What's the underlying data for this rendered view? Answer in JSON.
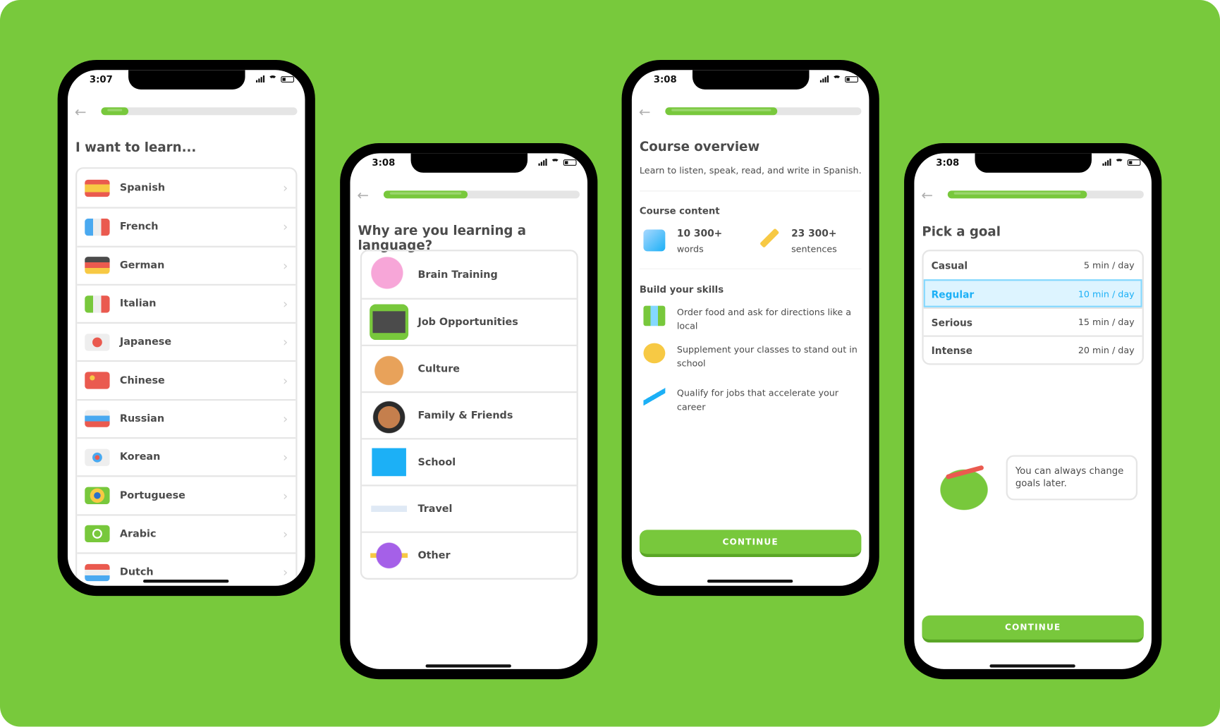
{
  "background_color": "#78c93c",
  "accent_color": "#78c83c",
  "phones": [
    {
      "time": "3:07",
      "progress": 0.14,
      "title": "I want to learn...",
      "languages": [
        {
          "label": "Spanish",
          "icon": "flag-spain"
        },
        {
          "label": "French",
          "icon": "flag-france"
        },
        {
          "label": "German",
          "icon": "flag-germany"
        },
        {
          "label": "Italian",
          "icon": "flag-italy"
        },
        {
          "label": "Japanese",
          "icon": "flag-japan"
        },
        {
          "label": "Chinese",
          "icon": "flag-china"
        },
        {
          "label": "Russian",
          "icon": "flag-russia"
        },
        {
          "label": "Korean",
          "icon": "flag-korea"
        },
        {
          "label": "Portuguese",
          "icon": "flag-brazil"
        },
        {
          "label": "Arabic",
          "icon": "flag-arabic"
        },
        {
          "label": "Dutch",
          "icon": "flag-netherlands"
        }
      ]
    },
    {
      "time": "3:08",
      "progress": 0.43,
      "title": "Why are you learning a language?",
      "reasons": [
        {
          "label": "Brain Training",
          "icon": "brain-icon"
        },
        {
          "label": "Job Opportunities",
          "icon": "laptop-chart-icon"
        },
        {
          "label": "Culture",
          "icon": "palette-icon"
        },
        {
          "label": "Family & Friends",
          "icon": "person-icon"
        },
        {
          "label": "School",
          "icon": "book-icon"
        },
        {
          "label": "Travel",
          "icon": "airplane-icon"
        },
        {
          "label": "Other",
          "icon": "planet-icon"
        }
      ]
    },
    {
      "time": "3:08",
      "progress": 0.57,
      "title": "Course overview",
      "subtitle": "Learn to listen, speak, read, and write in Spanish.",
      "content_heading": "Course content",
      "stats": [
        {
          "value": "10 300+",
          "unit": "words",
          "icon": "cards-icon"
        },
        {
          "value": "23 300+",
          "unit": "sentences",
          "icon": "pencil-icon"
        }
      ],
      "skills_heading": "Build your skills",
      "skills": [
        {
          "text": "Order food and ask for directions like a local",
          "icon": "map-icon"
        },
        {
          "text": "Supplement your classes to stand out in school",
          "icon": "lightbulb-icon"
        },
        {
          "text": "Qualify for jobs that accelerate your career",
          "icon": "trend-up-icon"
        }
      ],
      "continue_label": "CONTINUE"
    },
    {
      "time": "3:08",
      "progress": 0.71,
      "title": "Pick a goal",
      "goals": [
        {
          "name": "Casual",
          "time": "5 min / day",
          "selected": false
        },
        {
          "name": "Regular",
          "time": "10 min / day",
          "selected": true
        },
        {
          "name": "Serious",
          "time": "15 min / day",
          "selected": false
        },
        {
          "name": "Intense",
          "time": "20 min / day",
          "selected": false
        }
      ],
      "bubble_text": "You can always change goals later.",
      "continue_label": "CONTINUE"
    }
  ]
}
